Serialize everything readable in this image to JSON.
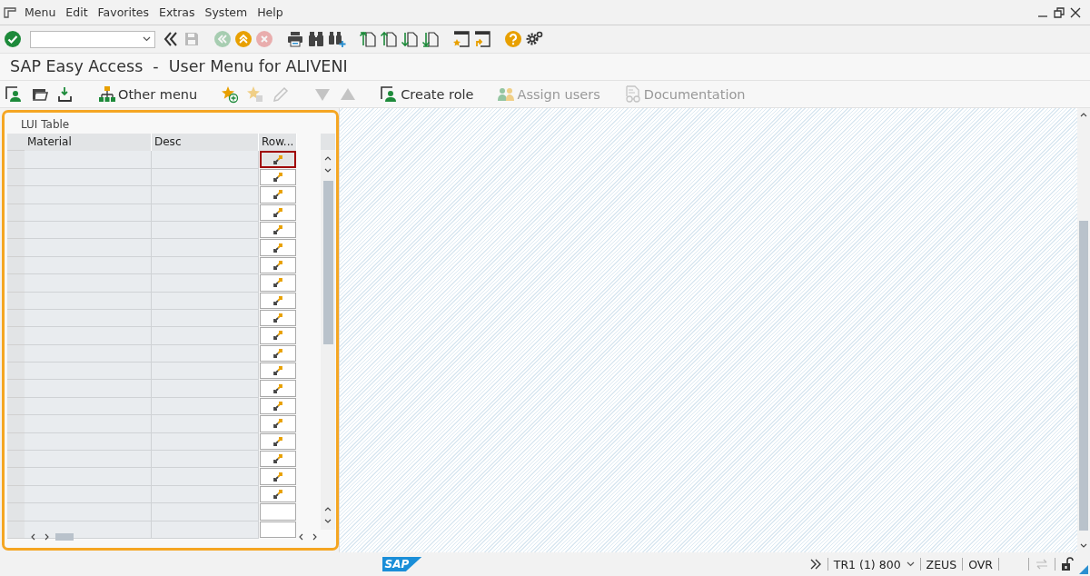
{
  "menu_bar": {
    "items": [
      "Menu",
      "Edit",
      "Favorites",
      "Extras",
      "System",
      "Help"
    ]
  },
  "toolbar": {
    "buttons": [
      {
        "kind": "back-double",
        "disabled": false
      },
      {
        "kind": "save",
        "disabled": true
      },
      {
        "kind": "back",
        "disabled": true
      },
      {
        "kind": "exit",
        "disabled": false
      },
      {
        "kind": "cancel",
        "disabled": true
      },
      {
        "kind": "print",
        "disabled": false
      },
      {
        "kind": "find",
        "disabled": false
      },
      {
        "kind": "find-next",
        "disabled": false
      },
      {
        "kind": "first-page",
        "disabled": false
      },
      {
        "kind": "prev-page",
        "disabled": false
      },
      {
        "kind": "next-page",
        "disabled": false
      },
      {
        "kind": "last-page",
        "disabled": false
      },
      {
        "kind": "new-session",
        "disabled": false
      },
      {
        "kind": "shortcut",
        "disabled": false
      },
      {
        "kind": "help",
        "disabled": false
      },
      {
        "kind": "settings",
        "disabled": false
      }
    ]
  },
  "title": "SAP Easy Access  -  User Menu for ALIVENI",
  "app_toolbar": [
    {
      "kind": "user-menu",
      "disabled": false
    },
    {
      "kind": "sap-menu",
      "disabled": false
    },
    {
      "kind": "business-workplace",
      "disabled": false
    },
    {
      "kind": "other-menu",
      "label": "Other menu",
      "disabled": false
    },
    {
      "kind": "add-favorite",
      "disabled": false
    },
    {
      "kind": "delete-favorite",
      "disabled": true
    },
    {
      "kind": "edit",
      "disabled": true
    },
    {
      "kind": "move-down",
      "disabled": true
    },
    {
      "kind": "move-up",
      "disabled": true
    },
    {
      "kind": "create-role",
      "label": "Create role",
      "disabled": false
    },
    {
      "kind": "assign-users",
      "label": "Assign users",
      "disabled": true
    },
    {
      "kind": "documentation",
      "label": "Documentation",
      "disabled": true
    }
  ],
  "table": {
    "title": "LUI Table",
    "columns": [
      "Material",
      "Desc",
      "Row..."
    ],
    "rows": [
      {
        "kind": "button",
        "focused": true
      },
      {
        "kind": "button",
        "focused": false
      },
      {
        "kind": "button",
        "focused": false
      },
      {
        "kind": "button",
        "focused": false
      },
      {
        "kind": "button",
        "focused": false
      },
      {
        "kind": "button",
        "focused": false
      },
      {
        "kind": "button",
        "focused": false
      },
      {
        "kind": "button",
        "focused": false
      },
      {
        "kind": "button",
        "focused": false
      },
      {
        "kind": "button",
        "focused": false
      },
      {
        "kind": "button",
        "focused": false
      },
      {
        "kind": "button",
        "focused": false
      },
      {
        "kind": "button",
        "focused": false
      },
      {
        "kind": "button",
        "focused": false
      },
      {
        "kind": "button",
        "focused": false
      },
      {
        "kind": "button",
        "focused": false
      },
      {
        "kind": "button",
        "focused": false
      },
      {
        "kind": "button",
        "focused": false
      },
      {
        "kind": "button",
        "focused": false
      },
      {
        "kind": "button",
        "focused": false
      },
      {
        "kind": "empty",
        "focused": false
      },
      {
        "kind": "empty",
        "focused": false
      }
    ]
  },
  "status_bar": {
    "logo": "SAP",
    "system": "TR1 (1) 800",
    "server": "ZEUS",
    "mode": "OVR"
  }
}
